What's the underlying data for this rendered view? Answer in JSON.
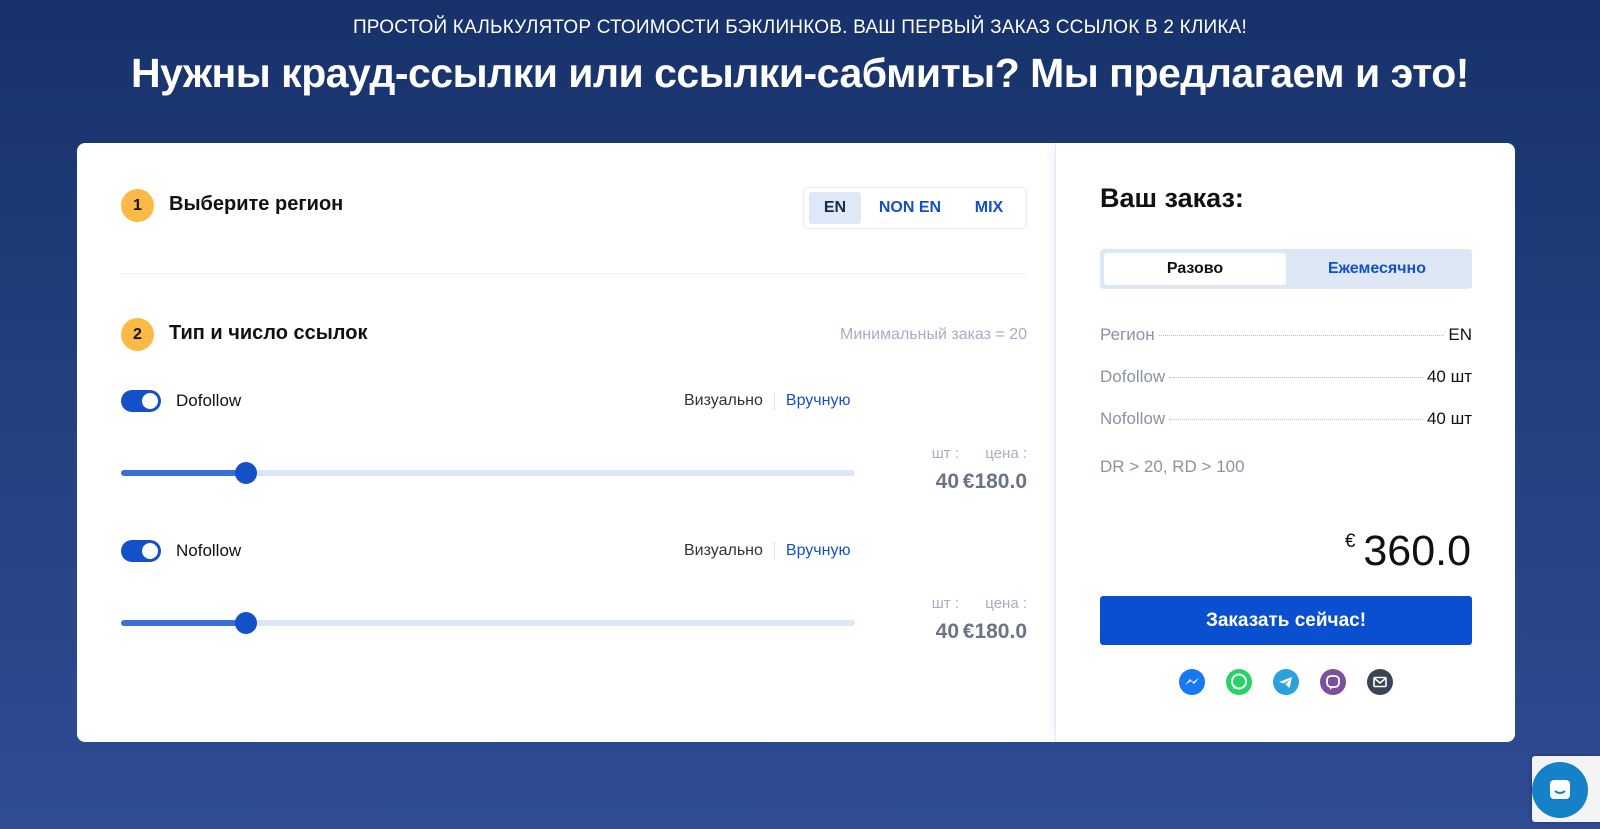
{
  "header": {
    "subtitle": "ПРОСТОЙ КАЛЬКУЛЯТОР СТОИМОСТИ БЭКЛИНКОВ. ВАШ ПЕРВЫЙ ЗАКАЗ ССЫЛОК В 2 КЛИКА!",
    "title": "Нужны крауд-ссылки или ссылки-сабмиты? Мы предлагаем и это!"
  },
  "step1": {
    "number": "1",
    "title": "Выберите регион",
    "regions": [
      "EN",
      "NON EN",
      "MIX"
    ],
    "selected_region": "EN"
  },
  "step2": {
    "number": "2",
    "title": "Тип и число ссылок",
    "min_order": "Минимальный заказ = 20",
    "rows": [
      {
        "label": "Dofollow",
        "enabled": true,
        "mode_visual": "Визуально",
        "mode_manual": "Вручную",
        "qty_label": "шт :",
        "price_label": "цена :",
        "qty": "40",
        "price": "€180.0",
        "slider_fraction": 0.17
      },
      {
        "label": "Nofollow",
        "enabled": true,
        "mode_visual": "Визуально",
        "mode_manual": "Вручную",
        "qty_label": "шт :",
        "price_label": "цена :",
        "qty": "40",
        "price": "€180.0",
        "slider_fraction": 0.17
      }
    ]
  },
  "order": {
    "title": "Ваш заказ:",
    "period_options": [
      "Разово",
      "Ежемесячно"
    ],
    "selected_period": "Разово",
    "summary": [
      {
        "key": "Регион",
        "value": "EN"
      },
      {
        "key": "Dofollow",
        "value": "40 шт"
      },
      {
        "key": "Nofollow",
        "value": "40 шт"
      }
    ],
    "criteria": "DR > 20, RD > 100",
    "currency": "€",
    "total": "360.0",
    "cta": "Заказать сейчас!"
  },
  "socials": [
    "messenger-icon",
    "whatsapp-icon",
    "telegram-icon",
    "viber-icon",
    "email-icon"
  ],
  "colors": {
    "accent": "#0a4fd0",
    "step_badge": "#fbb945",
    "messenger": "#1877f2",
    "whatsapp": "#25d366",
    "telegram": "#2aa1da",
    "viber": "#7b519d",
    "email": "#3b4455"
  }
}
